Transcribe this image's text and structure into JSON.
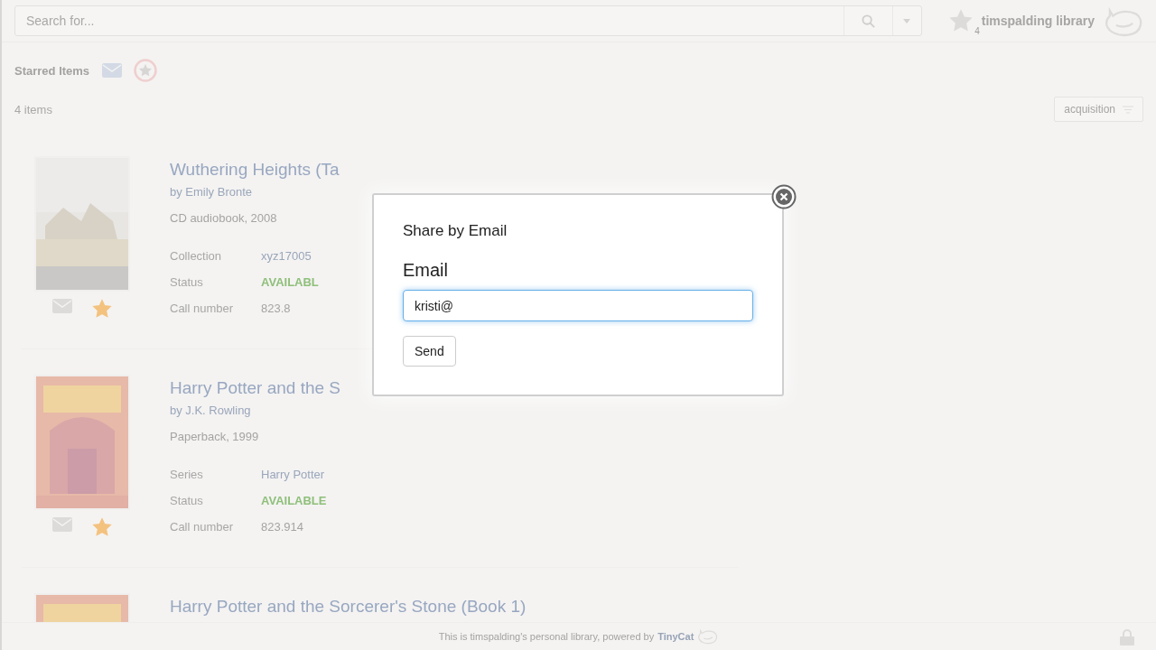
{
  "header": {
    "search": {
      "placeholder": "Search for..."
    },
    "star_count": "4",
    "library_name": "timspalding library"
  },
  "starred": {
    "title": "Starred Items"
  },
  "list": {
    "count": "4 items",
    "sort": "acquisition"
  },
  "books": [
    {
      "title": "Wuthering Heights (Ta",
      "author": "by Emily Bronte",
      "format": "CD audiobook, 2008",
      "starred": true,
      "fields": [
        {
          "label": "Collection",
          "value": "xyz17005",
          "kind": "link"
        },
        {
          "label": "Status",
          "value": "AVAILABL",
          "kind": "status"
        },
        {
          "label": "Call number",
          "value": "823.8",
          "kind": "plain"
        }
      ]
    },
    {
      "title": "Harry Potter and the S",
      "author": "by J.K. Rowling",
      "format": "Paperback, 1999",
      "starred": true,
      "fields": [
        {
          "label": "Series",
          "value": "Harry Potter",
          "kind": "link"
        },
        {
          "label": "Status",
          "value": "AVAILABLE",
          "kind": "status"
        },
        {
          "label": "Call number",
          "value": "823.914",
          "kind": "plain"
        }
      ]
    },
    {
      "title": "Harry Potter and the Sorcerer's Stone (Book 1)"
    }
  ],
  "footer": {
    "text": "This is timspalding's personal library, powered by",
    "brand": "TinyCat"
  },
  "modal": {
    "title": "Share by Email",
    "label": "Email",
    "value": "kristi@",
    "button": "Send"
  }
}
